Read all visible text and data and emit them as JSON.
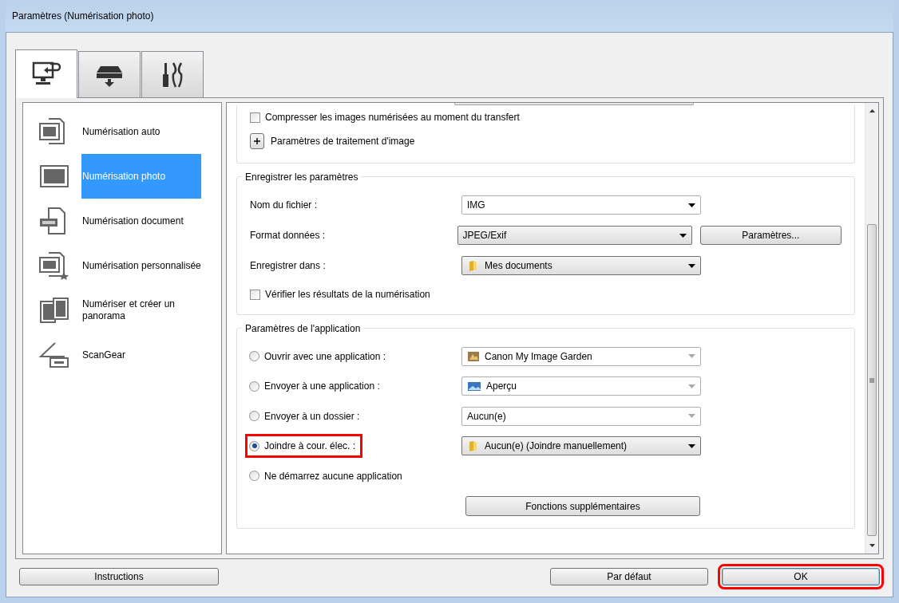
{
  "window": {
    "title": "Paramètres (Numérisation photo)"
  },
  "tabs": [
    {
      "selected": true
    },
    {
      "selected": false
    },
    {
      "selected": false
    }
  ],
  "sidebar": {
    "items": [
      {
        "label": "Numérisation auto",
        "selected": false
      },
      {
        "label": "Numérisation photo",
        "selected": true
      },
      {
        "label": "Numérisation document",
        "selected": false
      },
      {
        "label": "Numérisation personnalisée",
        "selected": false
      },
      {
        "label": "Numériser et créer un panorama",
        "selected": false
      },
      {
        "label": "ScanGear",
        "selected": false
      }
    ]
  },
  "scan_options": {
    "compress": {
      "label": "Compresser les images numérisées au moment du transfert",
      "checked": false
    },
    "image_processing": {
      "label": "Paramètres de traitement d'image",
      "expanded": false
    }
  },
  "save_settings": {
    "title": "Enregistrer les paramètres",
    "rows": [
      {
        "label": "Nom du fichier :",
        "value": "IMG",
        "kind": "combo"
      },
      {
        "label": "Format données :",
        "value": "JPEG/Exif",
        "kind": "select",
        "button": "Paramètres..."
      },
      {
        "label": "Enregistrer dans :",
        "value": "Mes documents",
        "kind": "select"
      }
    ],
    "check": {
      "label": "Vérifier les résultats de la numérisation",
      "checked": false
    }
  },
  "app_settings": {
    "title": "Paramètres de l'application",
    "options": [
      {
        "label": "Ouvrir avec une application :",
        "selected": false,
        "highlighted": false,
        "dropdown": {
          "value": "Canon My Image Garden",
          "disabled": true
        }
      },
      {
        "label": "Envoyer à une application :",
        "selected": false,
        "highlighted": false,
        "dropdown": {
          "value": "Aperçu",
          "disabled": true
        }
      },
      {
        "label": "Envoyer à un dossier :",
        "selected": false,
        "highlighted": false,
        "dropdown": {
          "value": "Aucun(e)",
          "disabled": true
        }
      },
      {
        "label": "Joindre à cour. élec. :",
        "selected": true,
        "highlighted": true,
        "dropdown": {
          "value": "Aucun(e) (Joindre manuellement)",
          "disabled": false
        }
      },
      {
        "label": "Ne démarrez aucune application",
        "selected": false,
        "highlighted": false
      }
    ],
    "button": "Fonctions supplémentaires"
  },
  "buttons": [
    {
      "label": "Instructions",
      "highlighted": false
    },
    {
      "label": "Par défaut",
      "highlighted": false
    },
    {
      "label": "OK",
      "highlighted": true
    }
  ]
}
